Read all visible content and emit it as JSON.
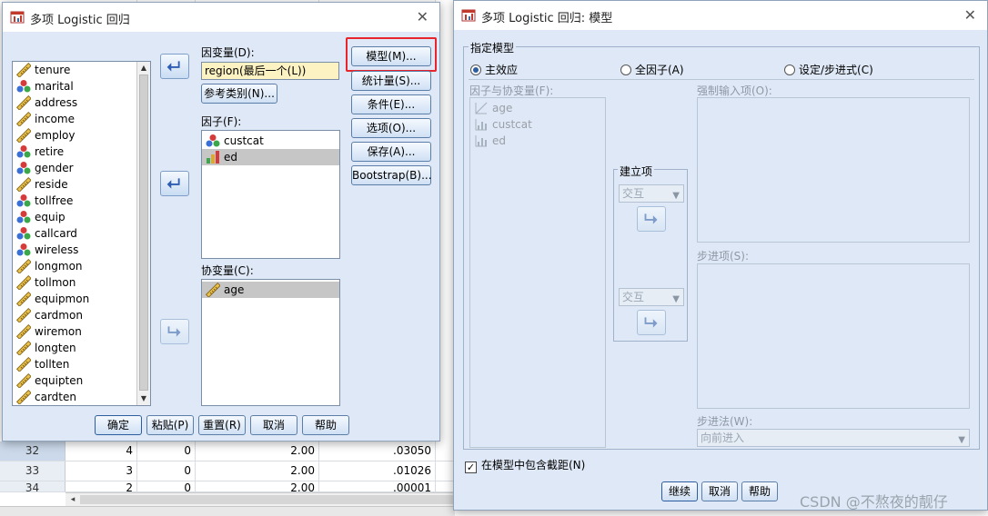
{
  "background_grid": {
    "rows": [
      {
        "num": "32",
        "c1": "4",
        "c2": "0",
        "c3": "2.00",
        "c4": ".03050"
      },
      {
        "num": "33",
        "c1": "3",
        "c2": "0",
        "c3": "2.00",
        "c4": ".01026"
      },
      {
        "num": "34",
        "c1": "2",
        "c2": "0",
        "c3": "2.00",
        "c4": ".00001"
      }
    ],
    "scroll_left": "◂"
  },
  "dialog_left": {
    "title": "多项 Logistic 回归",
    "close": "✕",
    "variables": [
      {
        "name": "tenure",
        "icon": "ruler-icon"
      },
      {
        "name": "marital",
        "icon": "nominal-icon"
      },
      {
        "name": "address",
        "icon": "ruler-icon"
      },
      {
        "name": "income",
        "icon": "ruler-icon"
      },
      {
        "name": "employ",
        "icon": "ruler-icon"
      },
      {
        "name": "retire",
        "icon": "nominal-icon"
      },
      {
        "name": "gender",
        "icon": "nominal-icon"
      },
      {
        "name": "reside",
        "icon": "ruler-icon"
      },
      {
        "name": "tollfree",
        "icon": "nominal-icon"
      },
      {
        "name": "equip",
        "icon": "nominal-icon"
      },
      {
        "name": "callcard",
        "icon": "nominal-icon"
      },
      {
        "name": "wireless",
        "icon": "nominal-icon"
      },
      {
        "name": "longmon",
        "icon": "ruler-icon"
      },
      {
        "name": "tollmon",
        "icon": "ruler-icon"
      },
      {
        "name": "equipmon",
        "icon": "ruler-icon"
      },
      {
        "name": "cardmon",
        "icon": "ruler-icon"
      },
      {
        "name": "wiremon",
        "icon": "ruler-icon"
      },
      {
        "name": "longten",
        "icon": "ruler-icon"
      },
      {
        "name": "tollten",
        "icon": "ruler-icon"
      },
      {
        "name": "equipten",
        "icon": "ruler-icon"
      },
      {
        "name": "cardten",
        "icon": "ruler-icon"
      }
    ],
    "dependent_label": "因变量(D):",
    "dependent_value": "region(最后一个(L))",
    "reference_button": "参考类别(N)...",
    "factors_label": "因子(F):",
    "factors": [
      {
        "name": "custcat",
        "icon": "nominal-icon"
      },
      {
        "name": "ed",
        "icon": "ordinal-icon"
      }
    ],
    "covariates_label": "协变量(C):",
    "covariates": [
      {
        "name": "age",
        "icon": "ruler-icon"
      }
    ],
    "side_buttons": {
      "model": "模型(M)...",
      "statistics": "统计量(S)...",
      "criteria": "条件(E)...",
      "options": "选项(O)...",
      "save": "保存(A)...",
      "bootstrap": "Bootstrap(B)..."
    },
    "bottom_buttons": {
      "ok": "确定",
      "paste": "粘贴(P)",
      "reset": "重置(R)",
      "cancel": "取消",
      "help": "帮助"
    },
    "highlight_color": "#e8242c"
  },
  "dialog_right": {
    "title": "多项 Logistic 回归: 模型",
    "close": "✕",
    "specify_model_label": "指定模型",
    "radios": {
      "main_effects": "主效应",
      "full_factorial": "全因子(A)",
      "custom": "设定/步进式(C)"
    },
    "selected_radio": "main_effects",
    "factors_covariates_label": "因子与协变量(F):",
    "factors_covariates": [
      {
        "name": "age",
        "icon": "scale-icon"
      },
      {
        "name": "custcat",
        "icon": "bars-icon"
      },
      {
        "name": "ed",
        "icon": "bars-icon"
      }
    ],
    "build_terms_label": "建立项",
    "term_type_1": "交互",
    "term_type_2": "交互",
    "forced_entry_label": "强制输入项(O):",
    "stepwise_label": "步进项(S):",
    "stepwise_method_label": "步进法(W):",
    "stepwise_method_value": "向前进入",
    "include_intercept_label": "在模型中包含截距(N)",
    "include_intercept_checked": "✓",
    "buttons": {
      "continue": "继续",
      "cancel": "取消",
      "help": "帮助"
    }
  },
  "watermark": "CSDN @不熬夜的靓仔"
}
